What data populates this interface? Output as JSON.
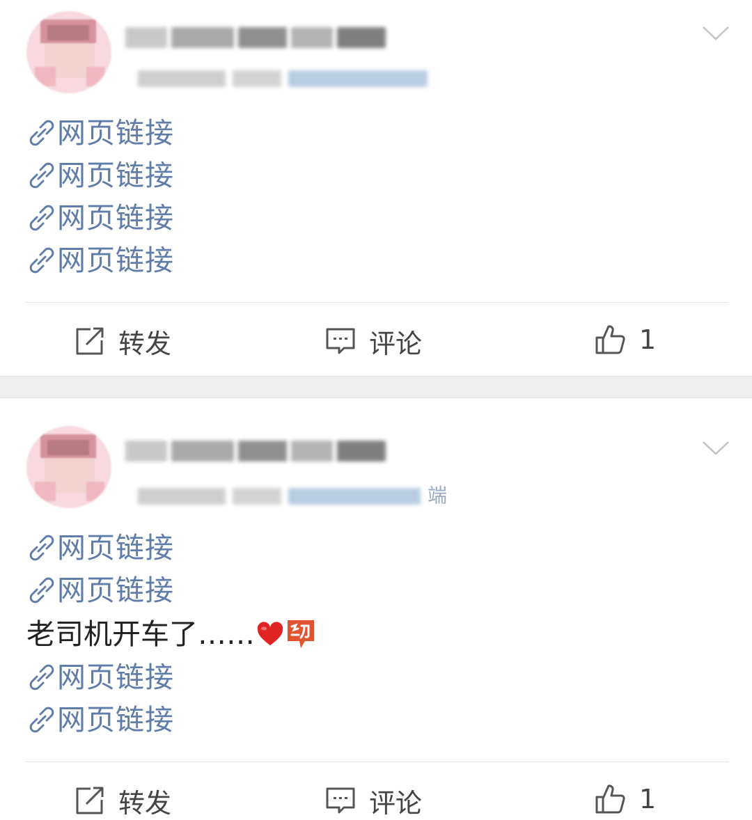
{
  "posts": [
    {
      "links": [
        "网页链接",
        "网页链接",
        "网页链接",
        "网页链接"
      ],
      "actions": {
        "repost": "转发",
        "comment": "评论",
        "like_count": "1"
      }
    },
    {
      "meta_fragment": "端",
      "links_before": [
        "网页链接",
        "网页链接"
      ],
      "text": "老司机开车了……",
      "emoji": [
        "heart",
        "moving-badge"
      ],
      "links_after": [
        "网页链接",
        "网页链接"
      ],
      "actions": {
        "repost": "转发",
        "comment": "评论",
        "like_count": "1"
      }
    }
  ],
  "colors": {
    "link": "#5f7da8",
    "text": "#222222",
    "action": "#444444",
    "heart": "#e02424",
    "badge": "#e0552f"
  }
}
